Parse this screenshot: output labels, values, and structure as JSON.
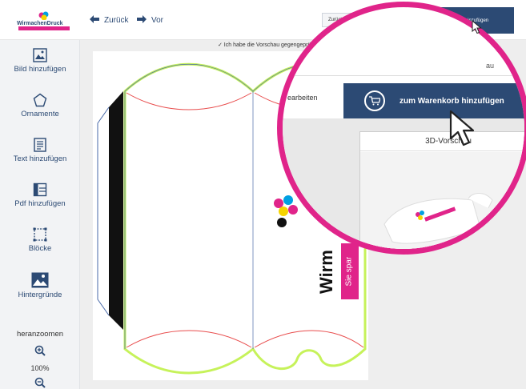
{
  "topbar": {
    "logo_name": "WirmachenDruck",
    "logo_tagline": "Sie sparen, wir drucken",
    "back_label": "Zurück",
    "forward_label": "Vor",
    "edit_back_label": "Zurück zum Bearbeiten",
    "cart_label": "zum Warenkorb hinzufügen"
  },
  "sidebar": {
    "items": [
      {
        "label": "Bild hinzufügen",
        "icon": "image-icon"
      },
      {
        "label": "Ornamente",
        "icon": "pentagon-icon"
      },
      {
        "label": "Text hinzufügen",
        "icon": "text-icon"
      },
      {
        "label": "Pdf hinzufügen",
        "icon": "pdf-icon"
      },
      {
        "label": "Blöcke",
        "icon": "blocks-icon"
      },
      {
        "label": "Hintergründe",
        "icon": "background-icon"
      }
    ],
    "zoom_label": "heranzoomen",
    "zoom_value": "100%"
  },
  "canvas": {
    "confirm_text": "✓ Ich habe die Vorschau gegengeprüft",
    "edit_partial": "earbeiten",
    "brand_text_1": "Wirm",
    "brand_text_2": "Sie spar"
  },
  "magnifier": {
    "cart_label": "zum Warenkorb hinzufügen",
    "preview_title": "3D-Vorschau",
    "panel_partial": "au",
    "edit_partial": "earbeiten",
    "nav_glyph": ">"
  },
  "colors": {
    "accent_navy": "#2c4a74",
    "highlight_pink": "#e0248a",
    "dieline_green": "#c6f25a",
    "dieline_red": "#e84b4b"
  }
}
